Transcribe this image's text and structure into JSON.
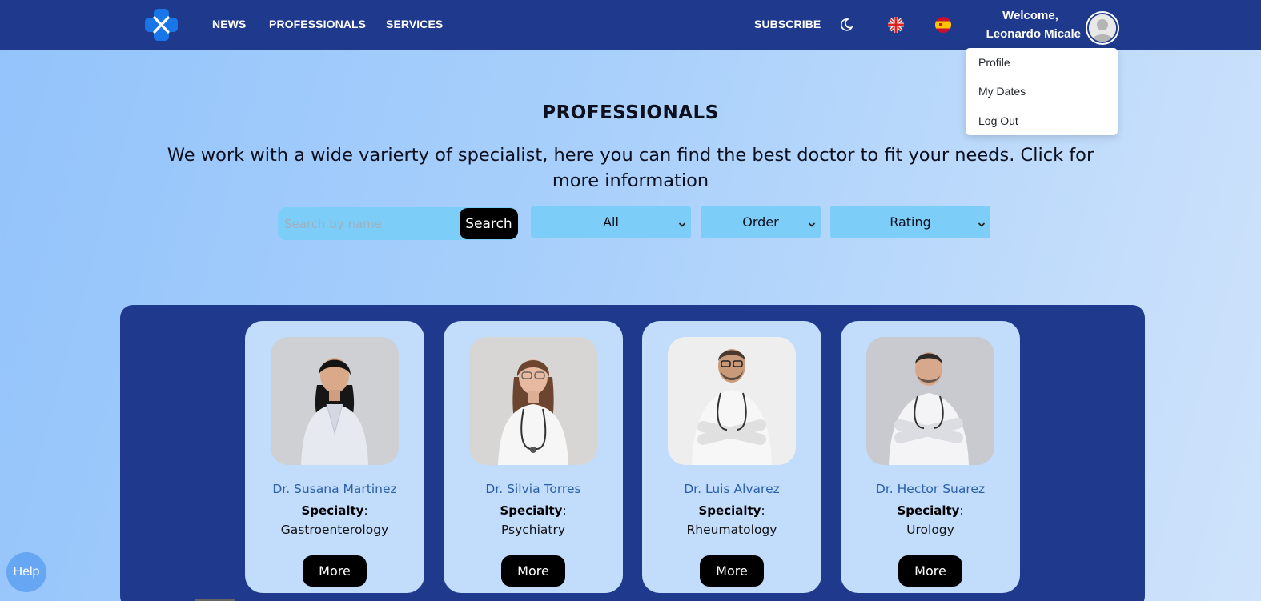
{
  "nav": {
    "links": [
      "NEWS",
      "PROFESSIONALS",
      "SERVICES"
    ],
    "subscribe": "SUBSCRIBE",
    "welcome_line1": "Welcome,",
    "welcome_line2": "Leonardo Micale"
  },
  "user_menu": {
    "items": [
      "Profile",
      "My Dates",
      "Log Out"
    ]
  },
  "hero": {
    "title": "PROFESSIONALS",
    "subtitle": "We work with a wide varierty of specialist, here you can find the best doctor to fit your needs. Click for more information"
  },
  "filters": {
    "search_placeholder": "Search by name",
    "search_button": "Search",
    "specialty_selected": "All",
    "order_selected": "Order",
    "rating_selected": "Rating"
  },
  "doctors": [
    {
      "name": "Dr. Susana Martinez",
      "specialty_label": "Specialty",
      "specialty": "Gastroenterology",
      "more": "More"
    },
    {
      "name": "Dr. Silvia Torres",
      "specialty_label": "Specialty",
      "specialty": "Psychiatry",
      "more": "More"
    },
    {
      "name": "Dr. Luis Alvarez",
      "specialty_label": "Specialty",
      "specialty": "Rheumatology",
      "more": "More"
    },
    {
      "name": "Dr. Hector Suarez",
      "specialty_label": "Specialty",
      "specialty": "Urology",
      "more": "More"
    }
  ],
  "help": "Help",
  "colors": {
    "navbar": "#1f3a8c",
    "card": "#c2dcfb",
    "control": "#7dcdf9",
    "doctor_name": "#2a5fa8"
  },
  "icons": [
    "app-logo-icon",
    "moon-icon",
    "uk-flag-icon",
    "spain-flag-icon",
    "user-avatar-icon",
    "select-caret-icon"
  ]
}
